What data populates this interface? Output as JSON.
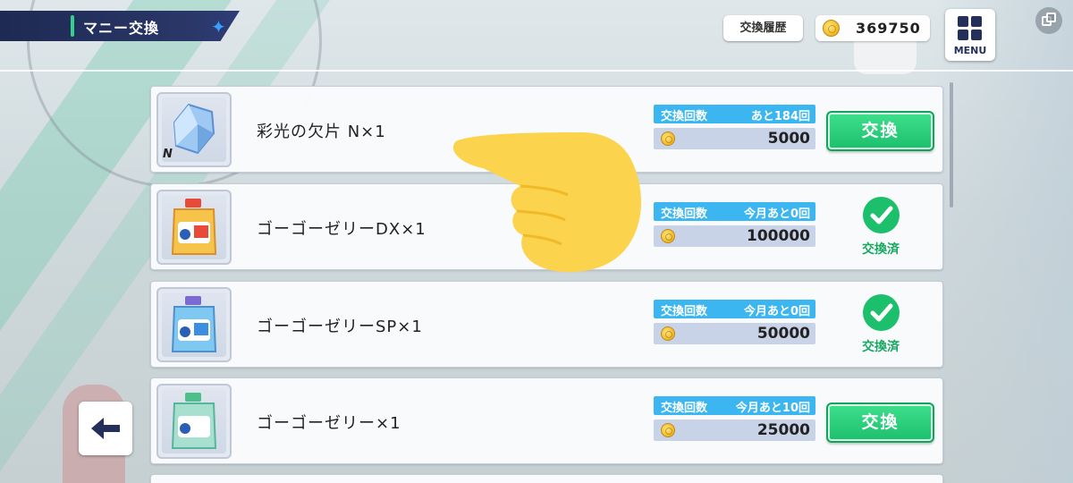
{
  "header": {
    "title": "マニー交換"
  },
  "top_bar": {
    "history_label": "交換履歴",
    "coin_balance": "369750",
    "menu_label": "MENU"
  },
  "colors": {
    "accent_green": "#1cbf6b",
    "label_blue": "#3bb6f0",
    "header_navy": "#25305a",
    "price_bg": "#c9d3e8"
  },
  "items": [
    {
      "name": "彩光の欠片 N×1",
      "count_key": "交換回数",
      "count_value": "あと184回",
      "price": "5000",
      "state": "button",
      "button_label": "交換",
      "icon": "crystal-shard-icon",
      "badge": "N"
    },
    {
      "name": "ゴーゴーゼリーDX×1",
      "count_key": "交換回数",
      "count_value": "今月あと0回",
      "price": "100000",
      "state": "done",
      "done_label": "交換済",
      "icon": "jelly-dx-icon"
    },
    {
      "name": "ゴーゴーゼリーSP×1",
      "count_key": "交換回数",
      "count_value": "今月あと0回",
      "price": "50000",
      "state": "done",
      "done_label": "交換済",
      "icon": "jelly-sp-icon"
    },
    {
      "name": "ゴーゴーゼリー×1",
      "count_key": "交換回数",
      "count_value": "今月あと10回",
      "price": "25000",
      "state": "button",
      "button_label": "交換",
      "icon": "jelly-icon"
    }
  ]
}
